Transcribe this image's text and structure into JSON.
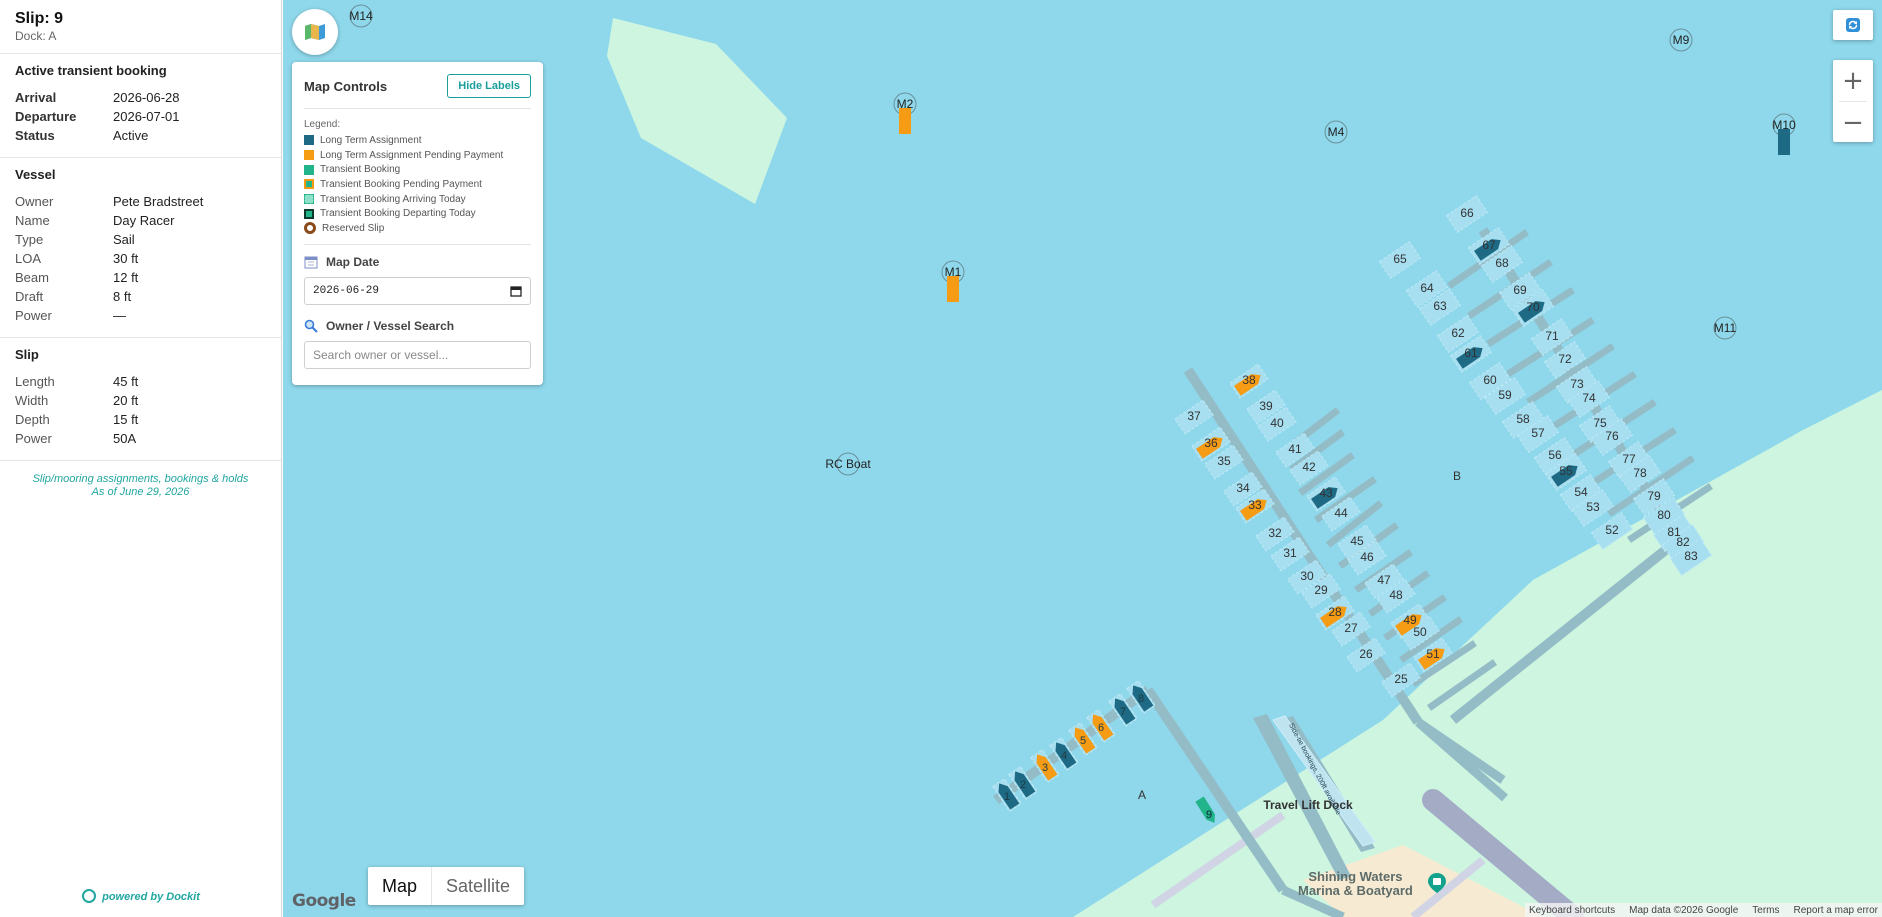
{
  "sidebar": {
    "title": "Slip: 9",
    "subtitle": "Dock: A",
    "booking": {
      "heading": "Active transient booking",
      "rows": [
        {
          "k": "Arrival",
          "v": "2026-06-28"
        },
        {
          "k": "Departure",
          "v": "2026-07-01"
        },
        {
          "k": "Status",
          "v": "Active"
        }
      ]
    },
    "vessel": {
      "heading": "Vessel",
      "rows": [
        {
          "k": "Owner",
          "v": "Pete Bradstreet"
        },
        {
          "k": "Name",
          "v": "Day Racer"
        },
        {
          "k": "Type",
          "v": "Sail"
        },
        {
          "k": "LOA",
          "v": "30 ft"
        },
        {
          "k": "Beam",
          "v": "12 ft"
        },
        {
          "k": "Draft",
          "v": "8 ft"
        },
        {
          "k": "Power",
          "v": "—"
        }
      ]
    },
    "slip": {
      "heading": "Slip",
      "rows": [
        {
          "k": "Length",
          "v": "45 ft"
        },
        {
          "k": "Width",
          "v": "20 ft"
        },
        {
          "k": "Depth",
          "v": "15 ft"
        },
        {
          "k": "Power",
          "v": "50A"
        }
      ]
    },
    "note_line1": "Slip/mooring assignments, bookings & holds",
    "note_line2": "As of June 29, 2026",
    "powered_by": "powered by Dockit"
  },
  "controls": {
    "title": "Map Controls",
    "hide_labels": "Hide Labels",
    "legend_title": "Legend:",
    "legend": [
      {
        "label": "Long Term Assignment",
        "color": "#1e6a85",
        "style": "solid"
      },
      {
        "label": "Long Term Assignment Pending Payment",
        "color": "#f59b14",
        "style": "solid"
      },
      {
        "label": "Transient Booking",
        "color": "#22b48a",
        "style": "solid"
      },
      {
        "label": "Transient Booking Pending Payment",
        "color": "#22b48a",
        "style": "orange-border"
      },
      {
        "label": "Transient Booking Arriving Today",
        "color": "#8fe0c8",
        "style": "dashed"
      },
      {
        "label": "Transient Booking Departing Today",
        "color": "#22b48a",
        "style": "dark-dashed"
      },
      {
        "label": "Reserved Slip",
        "color": "#8a4a1a",
        "style": "ring"
      }
    ],
    "map_date_label": "Map Date",
    "map_date_value": "2026-06-29",
    "search_label": "Owner / Vessel Search",
    "search_placeholder": "Search owner or vessel..."
  },
  "map": {
    "moorings": [
      "M14",
      "M2",
      "M1",
      "M4",
      "M9",
      "M10",
      "M11",
      "RC Boat"
    ],
    "dock_labels": [
      "A",
      "B",
      "Travel Lift Dock"
    ],
    "travel_lift_note": "Side-tie bookings, 200ft available",
    "place_line1": "Shining Waters",
    "place_line2": "Marina & Boatyard",
    "maptype_map": "Map",
    "maptype_satellite": "Satellite",
    "google": "Google",
    "attrib_keyboard": "Keyboard shortcuts",
    "attrib_data": "Map data ©2026 Google",
    "attrib_terms": "Terms",
    "attrib_report": "Report a map error",
    "zoom_in": "+",
    "zoom_out": "−"
  }
}
